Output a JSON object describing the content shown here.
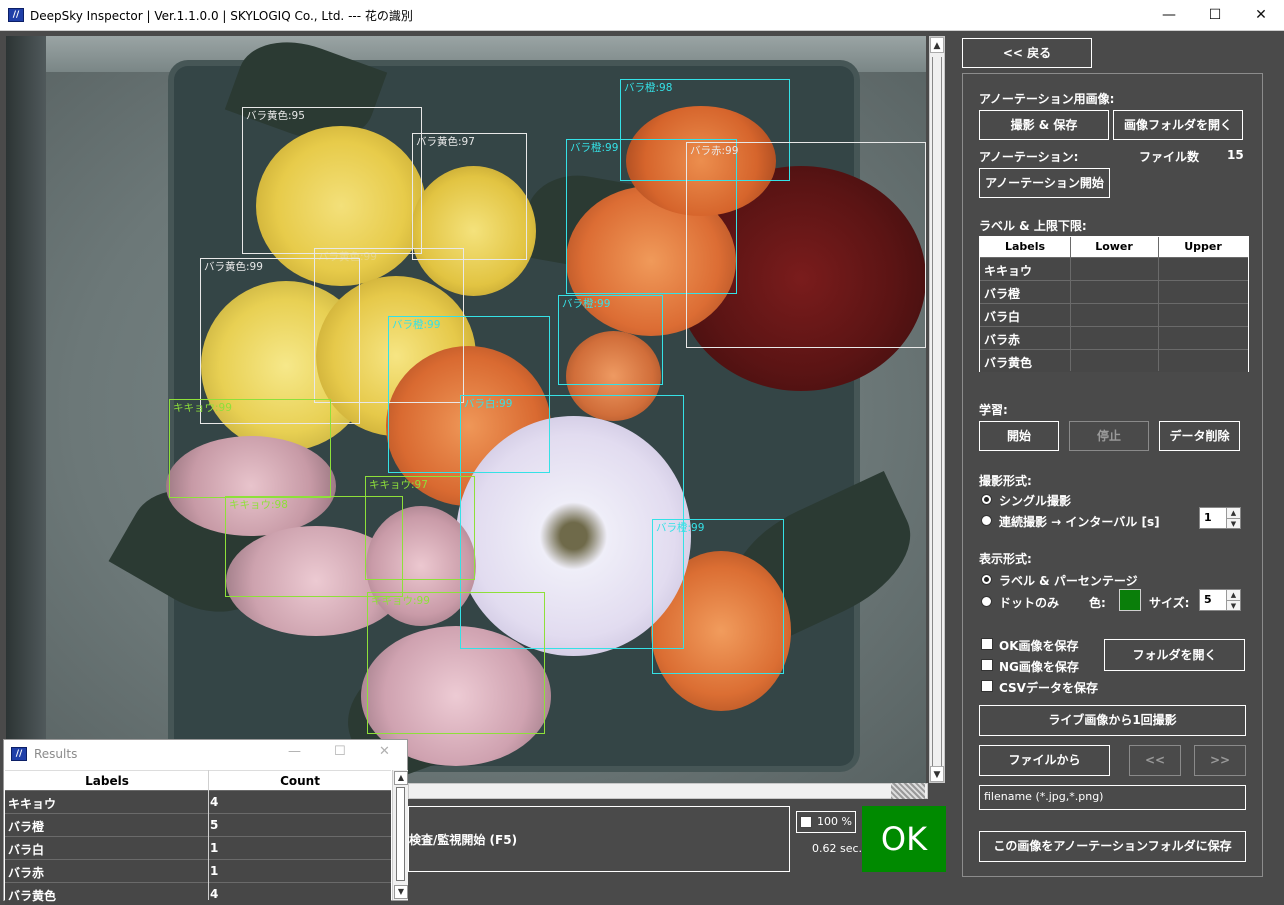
{
  "window": {
    "title": "DeepSky Inspector | Ver.1.1.0.0 | SKYLOGIQ Co., Ltd. --- 花の識別",
    "minimize_glyph": "—",
    "maximize_glyph": "☐",
    "close_glyph": "✕"
  },
  "detections": [
    {
      "label": "バラ黄色:95",
      "color": "white"
    },
    {
      "label": "バラ黄色:97",
      "color": "white"
    },
    {
      "label": "バラ黄色:99",
      "color": "white"
    },
    {
      "label": "バラ黄色:99",
      "color": "white"
    },
    {
      "label": "バラ橙:98",
      "color": "cyan"
    },
    {
      "label": "バラ橙:99",
      "color": "cyan"
    },
    {
      "label": "バラ赤:99",
      "color": "white"
    },
    {
      "label": "バラ橙:99",
      "color": "cyan"
    },
    {
      "label": "バラ橙:99",
      "color": "cyan"
    },
    {
      "label": "バラ白:99",
      "color": "cyan"
    },
    {
      "label": "キキョウ:99",
      "color": "green"
    },
    {
      "label": "キキョウ:98",
      "color": "green"
    },
    {
      "label": "キキョウ:97",
      "color": "green"
    },
    {
      "label": "キキョウ:99",
      "color": "green"
    },
    {
      "label": "バラ橙:99",
      "color": "cyan"
    }
  ],
  "inspection": {
    "start_label": "検査/監視開始 (F5)",
    "percent_label": "100 %",
    "elapsed": "0.62 sec.",
    "result": "OK",
    "result_color": "#008a00"
  },
  "panel": {
    "back_label": "<< 戻る",
    "annotation_image_label": "アノーテーション用画像:",
    "capture_save_label": "撮影 & 保存",
    "open_image_folder_label": "画像フォルダを開く",
    "annotation_label": "アノーテーション:",
    "file_count_label": "ファイル数",
    "file_count": "15",
    "annotation_start_label": "アノーテーション開始",
    "label_limits_label": "ラベル & 上限下限:",
    "label_table": {
      "headers": [
        "Labels",
        "Lower",
        "Upper"
      ],
      "rows": [
        "キキョウ",
        "バラ橙",
        "バラ白",
        "バラ赤",
        "バラ黄色"
      ]
    },
    "learning_label": "学習:",
    "start_label": "開始",
    "stop_label": "停止",
    "delete_data_label": "データ削除",
    "capture_mode_label": "撮影形式:",
    "single_label": "シングル撮影",
    "continuous_label": "連続撮影 → インターバル [s]",
    "interval_value": "1",
    "display_mode_label": "表示形式:",
    "label_percent_label": "ラベル & パーセンテージ",
    "dot_only_label": "ドットのみ",
    "color_label": "色:",
    "dot_color": "#0a7e0a",
    "size_label": "サイズ:",
    "size_value": "5",
    "save_ok_label": "OK画像を保存",
    "save_ng_label": "NG画像を保存",
    "save_csv_label": "CSVデータを保存",
    "open_folder_label": "フォルダを開く",
    "capture_once_label": "ライブ画像から1回撮影",
    "from_file_label": "ファイルから",
    "prev_label": "<<",
    "next_label": ">>",
    "filename_placeholder": "filename (*.jpg,*.png)",
    "save_to_annotation_label": "この画像をアノーテーションフォルダに保存"
  },
  "results": {
    "title": "Results",
    "headers": [
      "Labels",
      "Count"
    ],
    "rows": [
      {
        "label": "キキョウ",
        "count": "4"
      },
      {
        "label": "バラ橙",
        "count": "5"
      },
      {
        "label": "バラ白",
        "count": "1"
      },
      {
        "label": "バラ赤",
        "count": "1"
      },
      {
        "label": "バラ黄色",
        "count": "4"
      }
    ]
  }
}
